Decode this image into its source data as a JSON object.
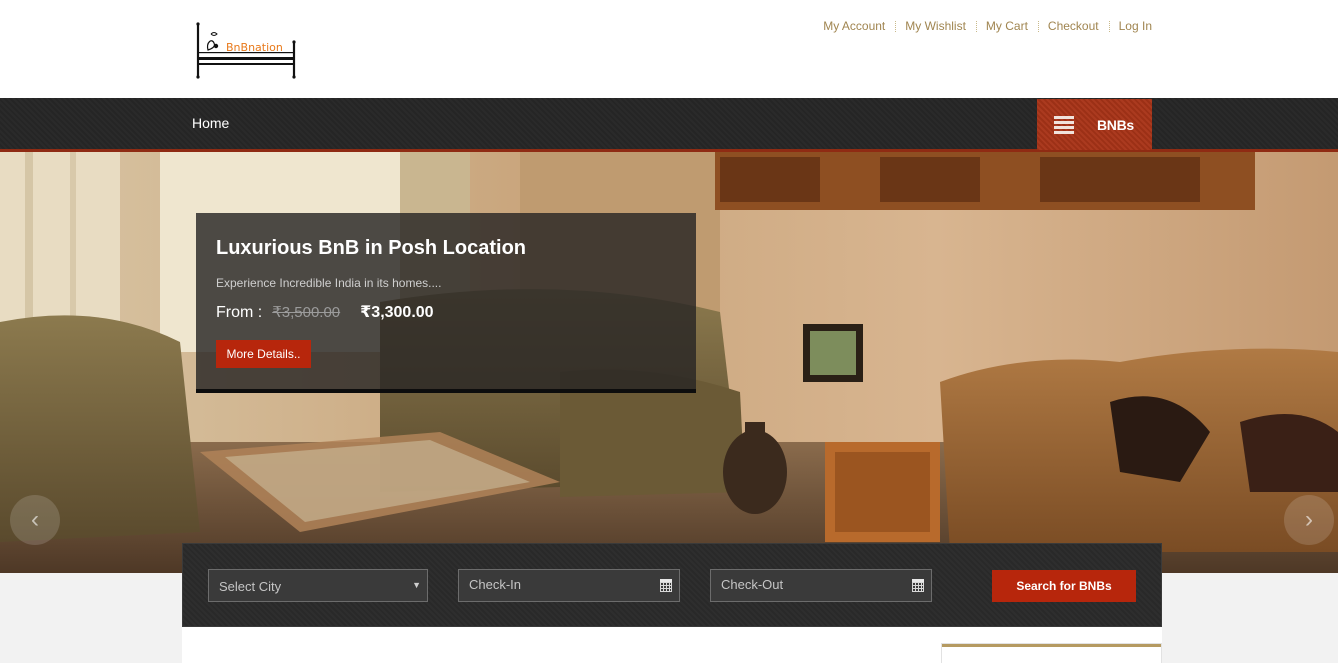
{
  "header": {
    "logo_text": "BnBnation",
    "links": [
      "My Account",
      "My Wishlist",
      "My Cart",
      "Checkout",
      "Log In"
    ]
  },
  "nav": {
    "home": "Home",
    "menu_label": "BNBs",
    "menu_icon": "hamburger-icon"
  },
  "slide": {
    "title": "Luxurious BnB in Posh Location",
    "subtitle": "Experience Incredible India in its homes....",
    "price_prefix": "From :",
    "old_price": "₹3,500.00",
    "new_price": "₹3,300.00",
    "cta": "More Details.."
  },
  "slider": {
    "prev_icon": "chevron-left-icon",
    "next_icon": "chevron-right-icon",
    "prev_glyph": "‹",
    "next_glyph": "›"
  },
  "search": {
    "city_value": "Select City",
    "checkin_placeholder": "Check-In",
    "checkout_placeholder": "Check-Out",
    "button": "Search for BNBs"
  },
  "colors": {
    "accent": "#b7260c",
    "link": "#a08550",
    "nav_bg": "#262626"
  }
}
